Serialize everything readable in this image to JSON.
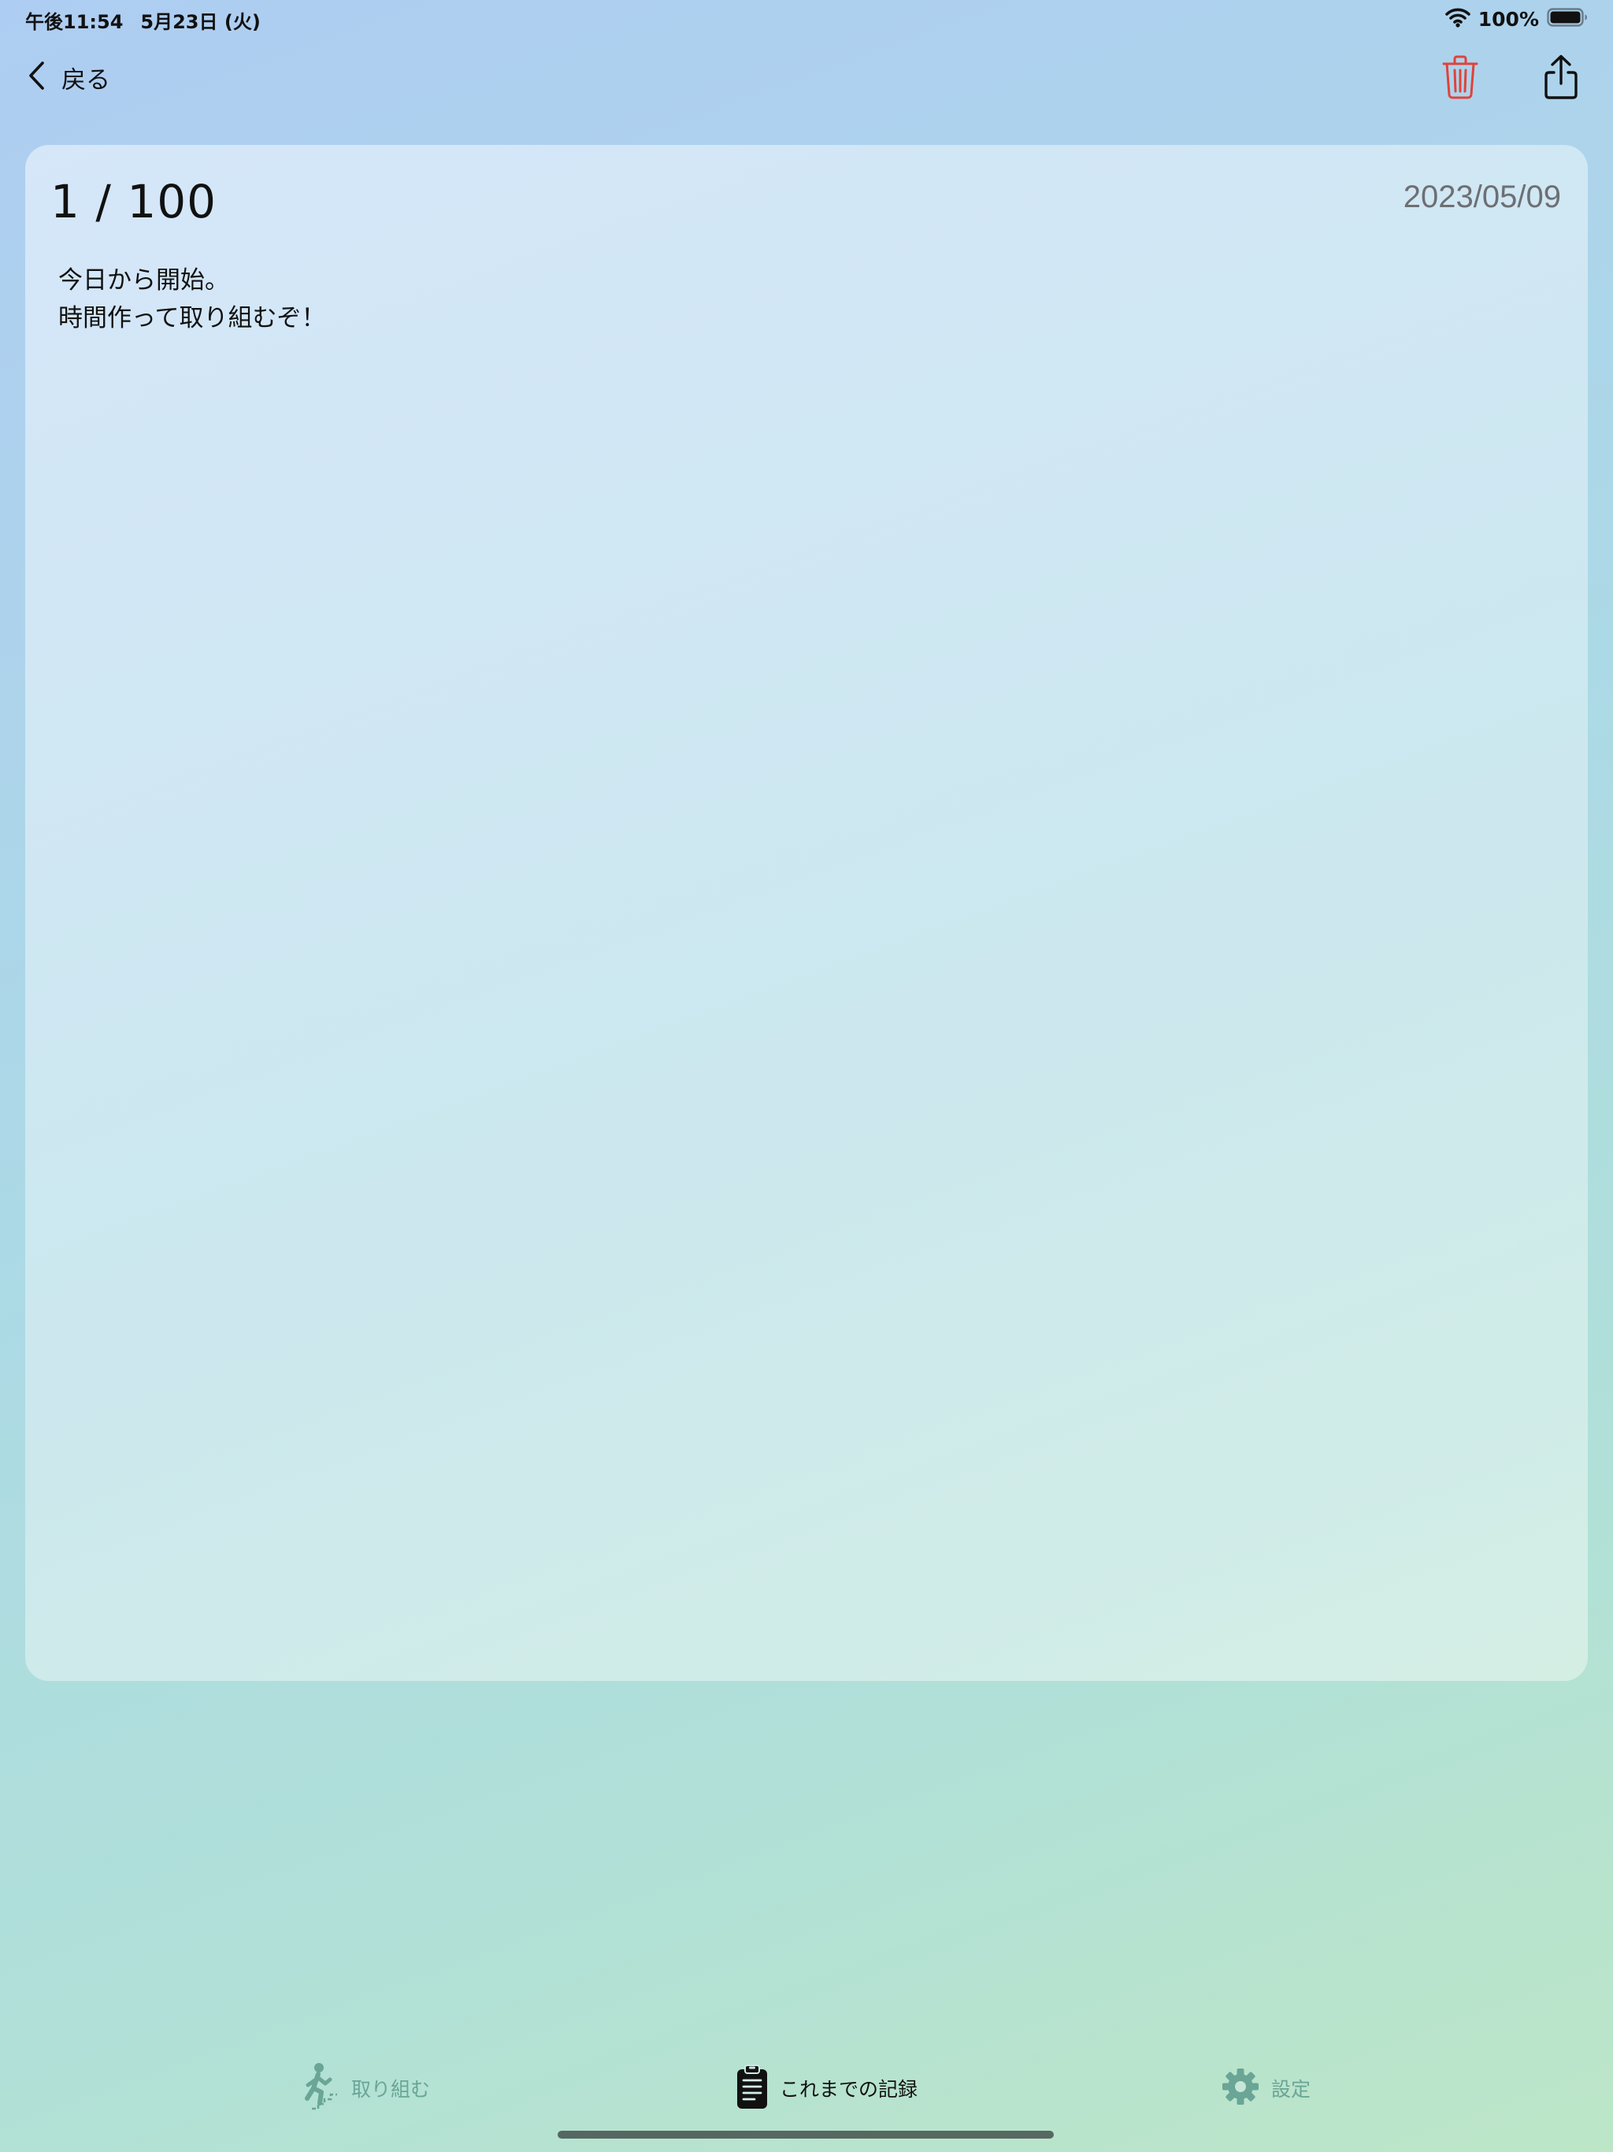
{
  "status_bar": {
    "time": "午後11:54",
    "date": "5月23日 (火)",
    "battery": "100%",
    "icons": [
      "wifi-icon",
      "battery-icon"
    ]
  },
  "nav": {
    "back_label": "戻る",
    "icons": [
      "chevron-left-icon",
      "trash-icon",
      "share-icon"
    ],
    "trash_color": "#e0433a"
  },
  "entry": {
    "count": "1 / 100",
    "date": "2023/05/09",
    "body_lines": [
      "今日から開始。",
      "時間作って取り組むぞ！"
    ]
  },
  "tab_bar": {
    "tabs": [
      {
        "label": "取り組む",
        "icon": "stairs-climber-icon",
        "active": false
      },
      {
        "label": "これまでの記録",
        "icon": "clipboard-icon",
        "active": true
      },
      {
        "label": "設定",
        "icon": "gear-icon",
        "active": false
      }
    ],
    "active_color": "#111111",
    "inactive_color": "#6aa596"
  }
}
